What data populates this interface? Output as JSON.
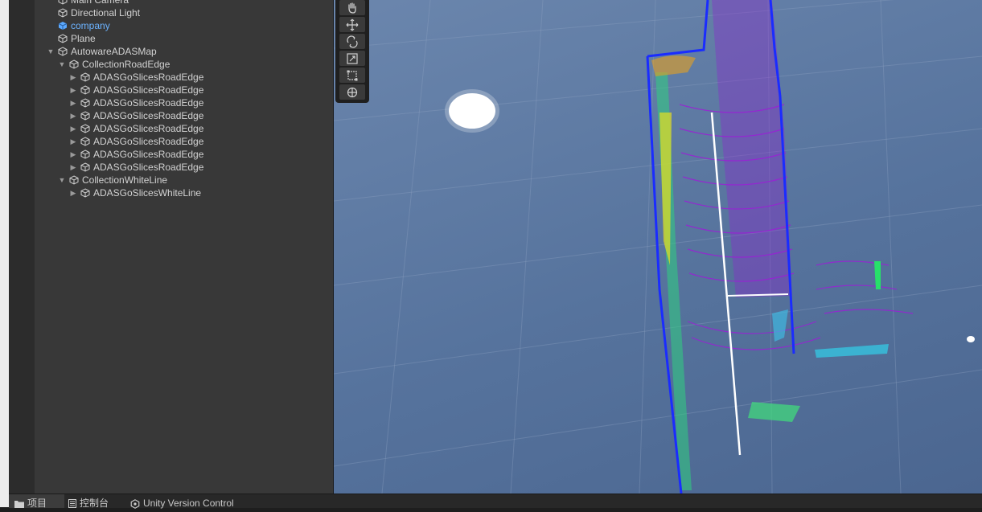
{
  "hierarchy": {
    "items": [
      {
        "label": "Main Camera",
        "icon": "cube-icon"
      },
      {
        "label": "Directional Light",
        "icon": "cube-icon"
      },
      {
        "label": "company",
        "icon": "prefab-cube-icon",
        "selected": true
      },
      {
        "label": "Plane",
        "icon": "cube-icon"
      },
      {
        "label": "AutowareADASMap",
        "icon": "cube-icon",
        "expanded": true
      },
      {
        "label": "CollectionRoadEdge",
        "icon": "cube-icon",
        "expanded": true
      },
      {
        "label": "ADASGoSlicesRoadEdge",
        "icon": "cube-icon",
        "collapsed": true
      },
      {
        "label": "ADASGoSlicesRoadEdge",
        "icon": "cube-icon",
        "collapsed": true
      },
      {
        "label": "ADASGoSlicesRoadEdge",
        "icon": "cube-icon",
        "collapsed": true
      },
      {
        "label": "ADASGoSlicesRoadEdge",
        "icon": "cube-icon",
        "collapsed": true
      },
      {
        "label": "ADASGoSlicesRoadEdge",
        "icon": "cube-icon",
        "collapsed": true
      },
      {
        "label": "ADASGoSlicesRoadEdge",
        "icon": "cube-icon",
        "collapsed": true
      },
      {
        "label": "ADASGoSlicesRoadEdge",
        "icon": "cube-icon",
        "collapsed": true
      },
      {
        "label": "ADASGoSlicesRoadEdge",
        "icon": "cube-icon",
        "collapsed": true
      },
      {
        "label": "CollectionWhiteLine",
        "icon": "cube-icon",
        "expanded": true
      },
      {
        "label": "ADASGoSlicesWhiteLine",
        "icon": "cube-icon",
        "collapsed": true
      }
    ]
  },
  "scene": {
    "tools": [
      "hand-tool-icon",
      "move-tool-icon",
      "rotate-tool-icon",
      "scale-tool-icon",
      "rect-tool-icon",
      "transform-tool-icon"
    ],
    "colors": {
      "sky": "#5f7ba4",
      "road_edge": "#1a2cff",
      "white_line": "#ffffff",
      "points_purple": "#9b1fd6",
      "points_green": "#27e06a"
    }
  },
  "bottom_tabs": [
    {
      "label": "项目",
      "icon": "folder-icon",
      "active": true
    },
    {
      "label": "控制台",
      "icon": "console-icon"
    },
    {
      "label": "Unity Version Control",
      "icon": "version-control-icon"
    }
  ]
}
